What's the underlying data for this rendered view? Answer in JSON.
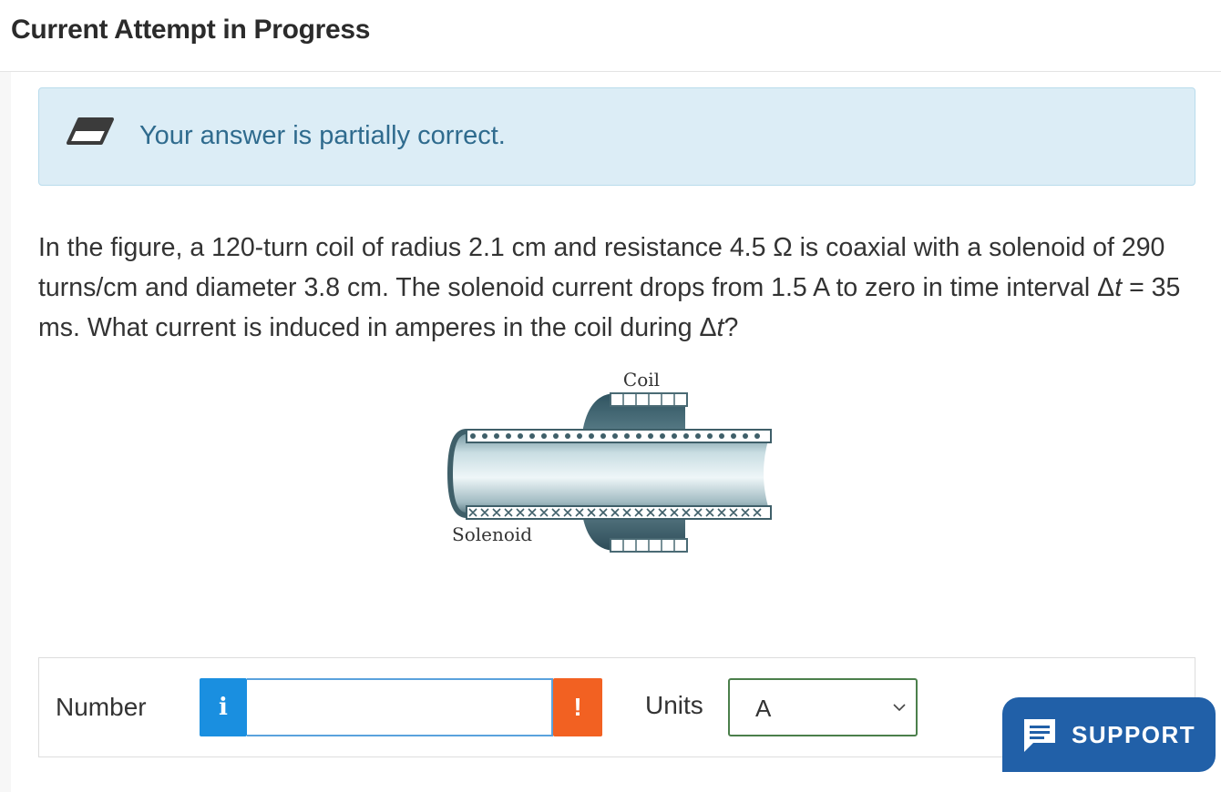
{
  "header": {
    "title": "Current Attempt in Progress"
  },
  "feedback": {
    "icon": "eraser-icon",
    "message": "Your answer is partially correct."
  },
  "question": {
    "text_parts": [
      "In the figure, a 120-turn coil of radius 2.1 cm and resistance 4.5 Ω is coaxial with a solenoid of 290 turns/cm and diameter 3.8 cm. The solenoid current drops from 1.5 A to zero in time interval Δ",
      "t",
      " = 35 ms. What current is induced in amperes in the coil during Δ",
      "t",
      "?"
    ]
  },
  "figure": {
    "coil_label": "Coil",
    "solenoid_label": "Solenoid"
  },
  "answer": {
    "number_label": "Number",
    "info_glyph": "i",
    "number_value": "",
    "warning_glyph": "!",
    "units_label": "Units",
    "units_selected": "A"
  },
  "support": {
    "label": "SUPPORT",
    "icon": "chat-icon"
  },
  "colors": {
    "feedback_bg": "#dcedf6",
    "feedback_text": "#2f6b8e",
    "info_blue": "#1a8fe0",
    "warning_orange": "#f26122",
    "support_blue": "#2160a8"
  }
}
